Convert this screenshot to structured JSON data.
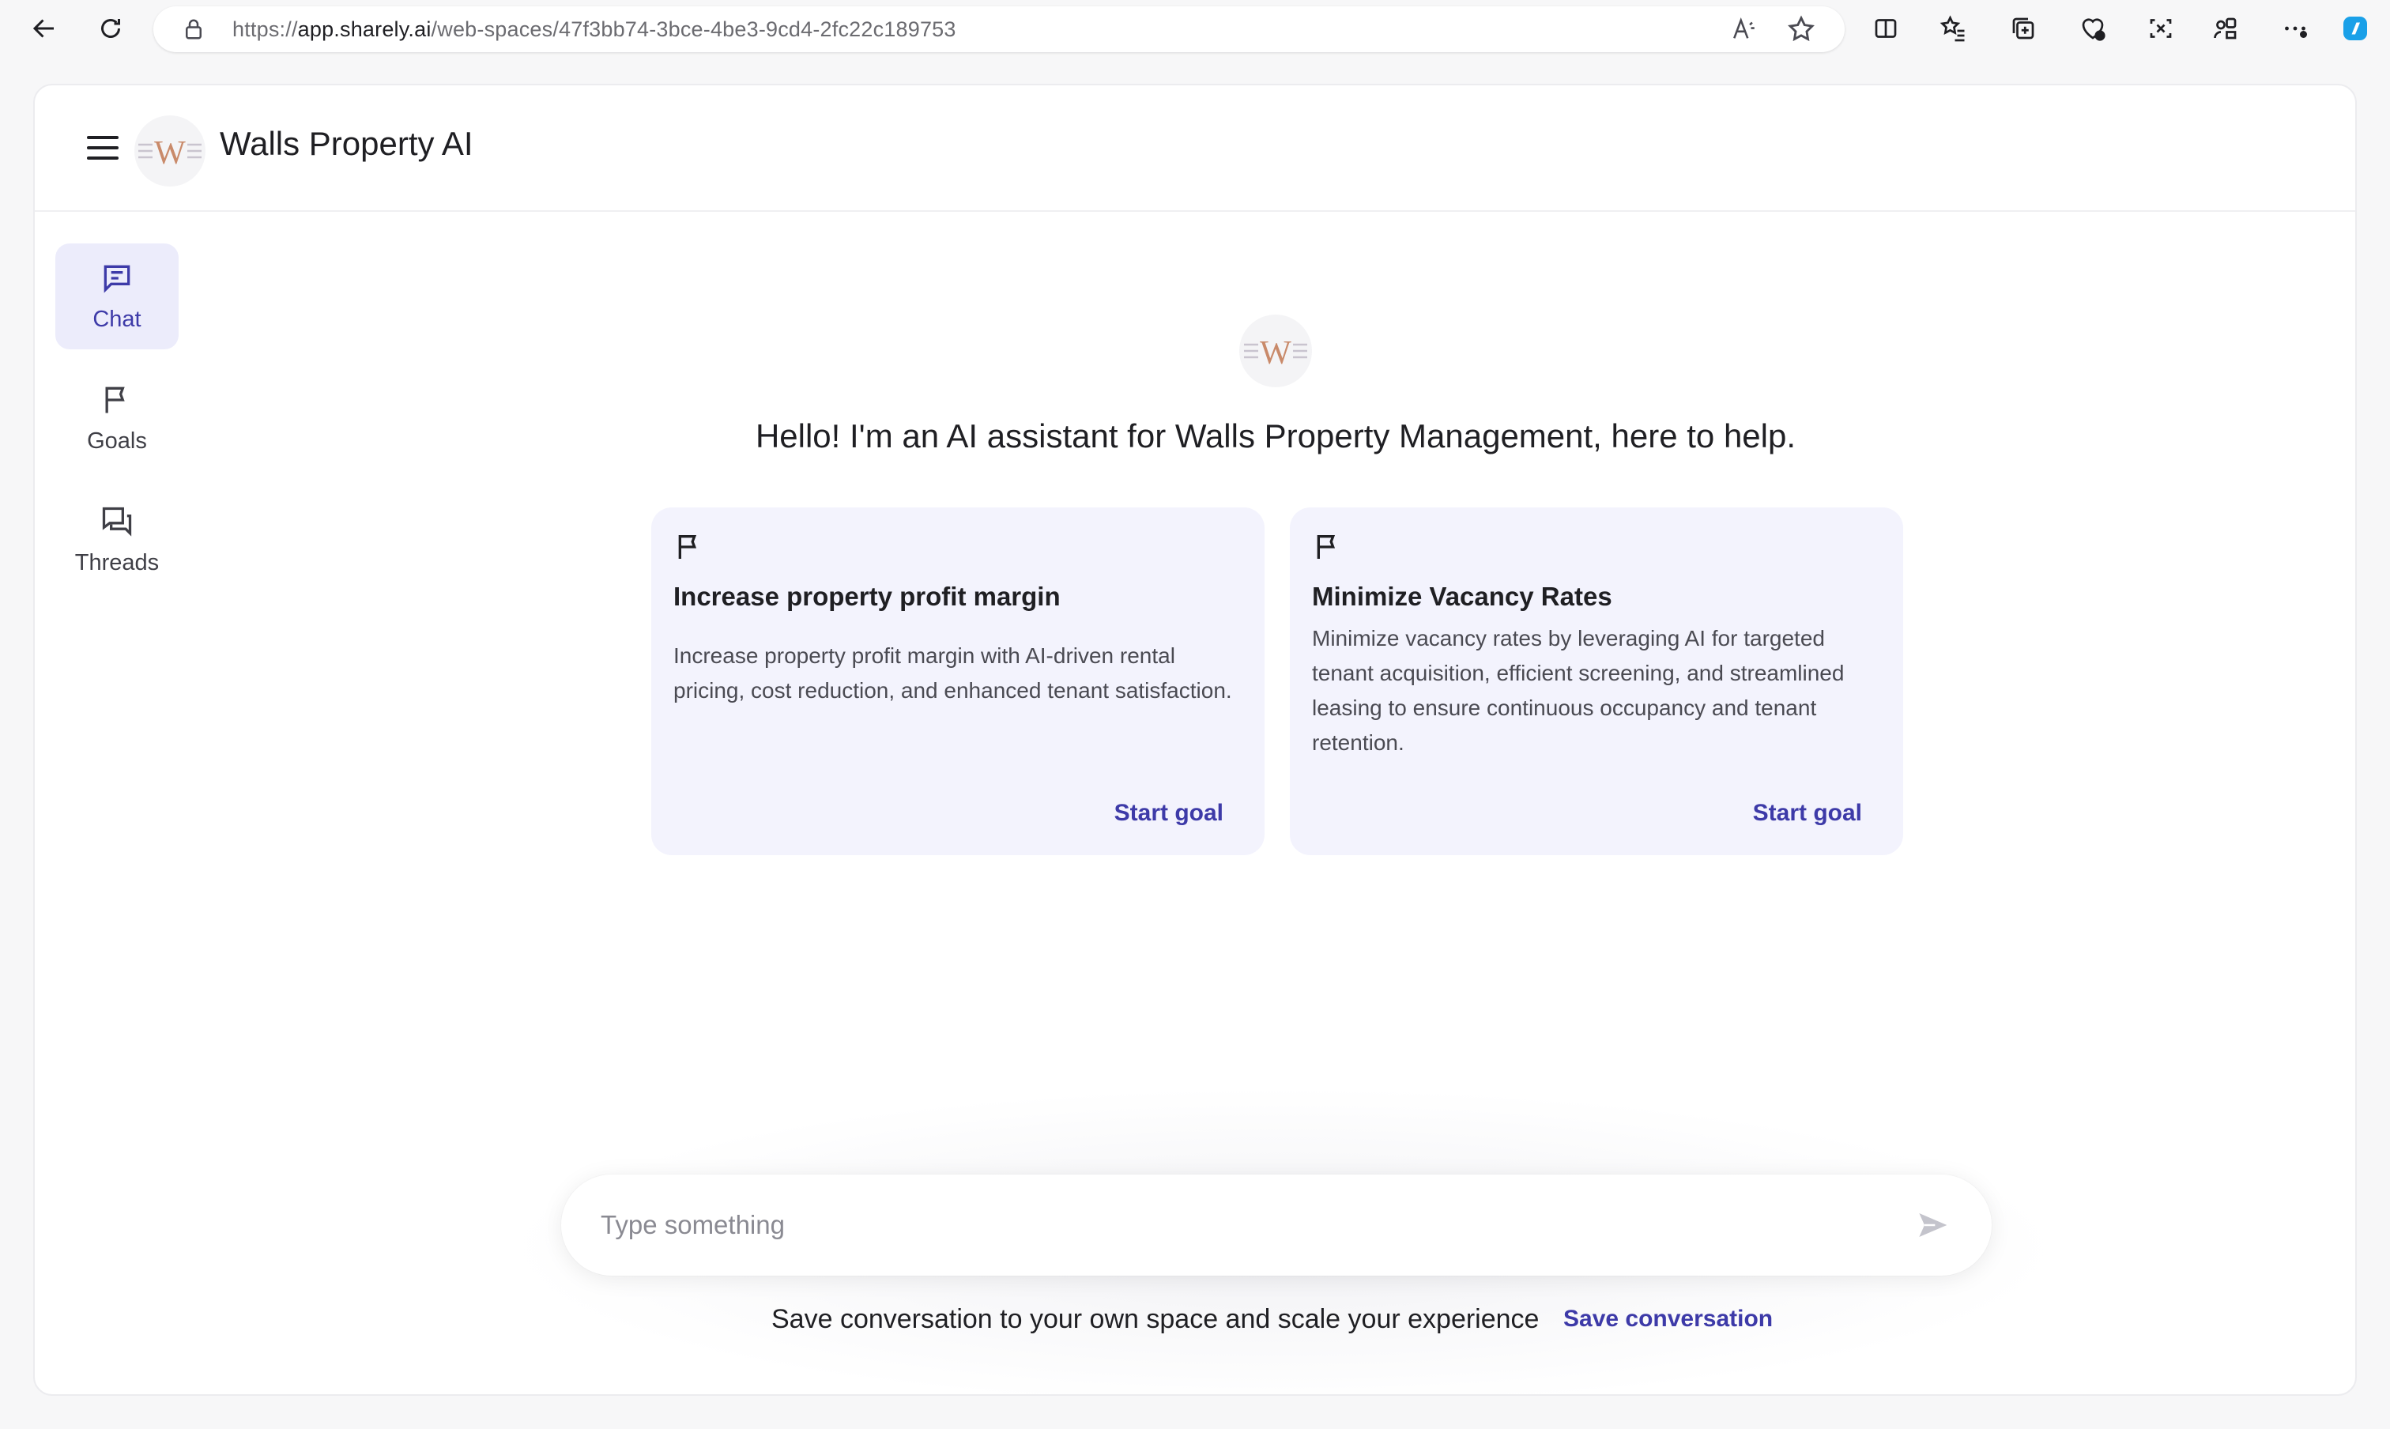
{
  "browser": {
    "url_prefix": "https://",
    "url_domain": "app.sharely.ai",
    "url_path": "/web-spaces/47f3bb74-3bce-4be3-9cd4-2fc22c189753"
  },
  "header": {
    "title": "Walls Property AI",
    "logo_letter": "W"
  },
  "sidebar": {
    "items": [
      {
        "label": "Chat",
        "icon": "chat-icon",
        "active": true
      },
      {
        "label": "Goals",
        "icon": "flag-icon",
        "active": false
      },
      {
        "label": "Threads",
        "icon": "threads-icon",
        "active": false
      }
    ]
  },
  "main": {
    "logo_letter": "W",
    "greeting": "Hello! I'm an AI assistant for Walls Property Management, here to help.",
    "goals": [
      {
        "title": "Increase property profit margin",
        "description": "Increase property profit margin with AI-driven rental pricing, cost reduction, and enhanced tenant satisfaction.",
        "action": "Start goal"
      },
      {
        "title": "Minimize Vacancy Rates",
        "description": "Minimize vacancy rates by leveraging AI for targeted tenant acquisition, efficient screening, and streamlined leasing to ensure continuous occupancy and tenant retention.",
        "action": "Start goal"
      }
    ]
  },
  "composer": {
    "placeholder": "Type something",
    "value": ""
  },
  "footer": {
    "save_prompt": "Save conversation to your own space and scale your experience",
    "save_link": "Save conversation"
  },
  "colors": {
    "accent": "#3d3aa8",
    "card_bg": "#f3f3fd",
    "active_nav_bg": "#ececfb",
    "logo_tan": "#c98a6a"
  }
}
